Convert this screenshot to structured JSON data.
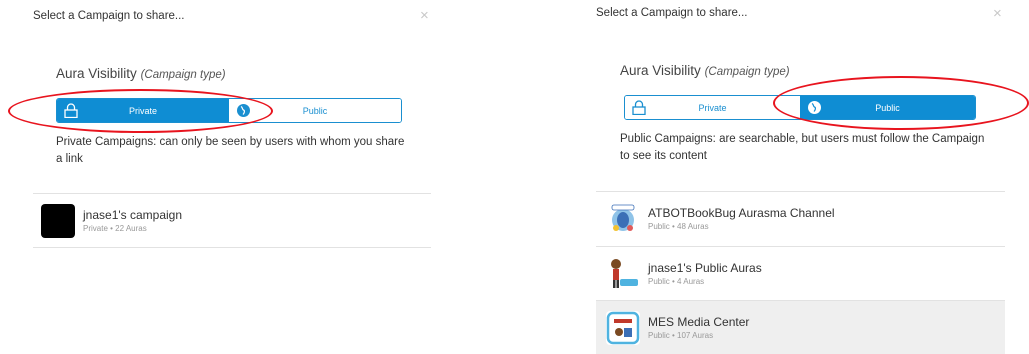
{
  "left": {
    "dialog_title": "Select a Campaign to share...",
    "close_label": "×",
    "section_title": "Aura Visibility",
    "section_subtitle": "(Campaign type)",
    "toggle": {
      "private_label": "Private",
      "public_label": "Public",
      "selected": "Private"
    },
    "description": "Private Campaigns: can only be seen by users with whom you share a link",
    "campaigns": [
      {
        "name": "jnase1's campaign",
        "meta": "Private • 22 Auras",
        "icon": "black-square"
      }
    ]
  },
  "right": {
    "dialog_title": "Select a Campaign to share...",
    "close_label": "×",
    "section_title": "Aura Visibility",
    "section_subtitle": "(Campaign type)",
    "toggle": {
      "private_label": "Private",
      "public_label": "Public",
      "selected": "Public"
    },
    "description": "Public Campaigns: are searchable, but users must follow the Campaign to see its content",
    "campaigns": [
      {
        "name": "ATBOTBookBug Aurasma Channel",
        "meta": "Public • 48 Auras",
        "icon": "bookbug-logo"
      },
      {
        "name": "jnase1's Public Auras",
        "meta": "Public • 4 Auras",
        "icon": "cartoon-figure"
      },
      {
        "name": "MES Media Center",
        "meta": "Public • 107 Auras",
        "icon": "media-center-logo"
      }
    ]
  },
  "colors": {
    "accent": "#0f8dd3",
    "annotation": "#e8141e",
    "highlight_row": "#efefef"
  }
}
